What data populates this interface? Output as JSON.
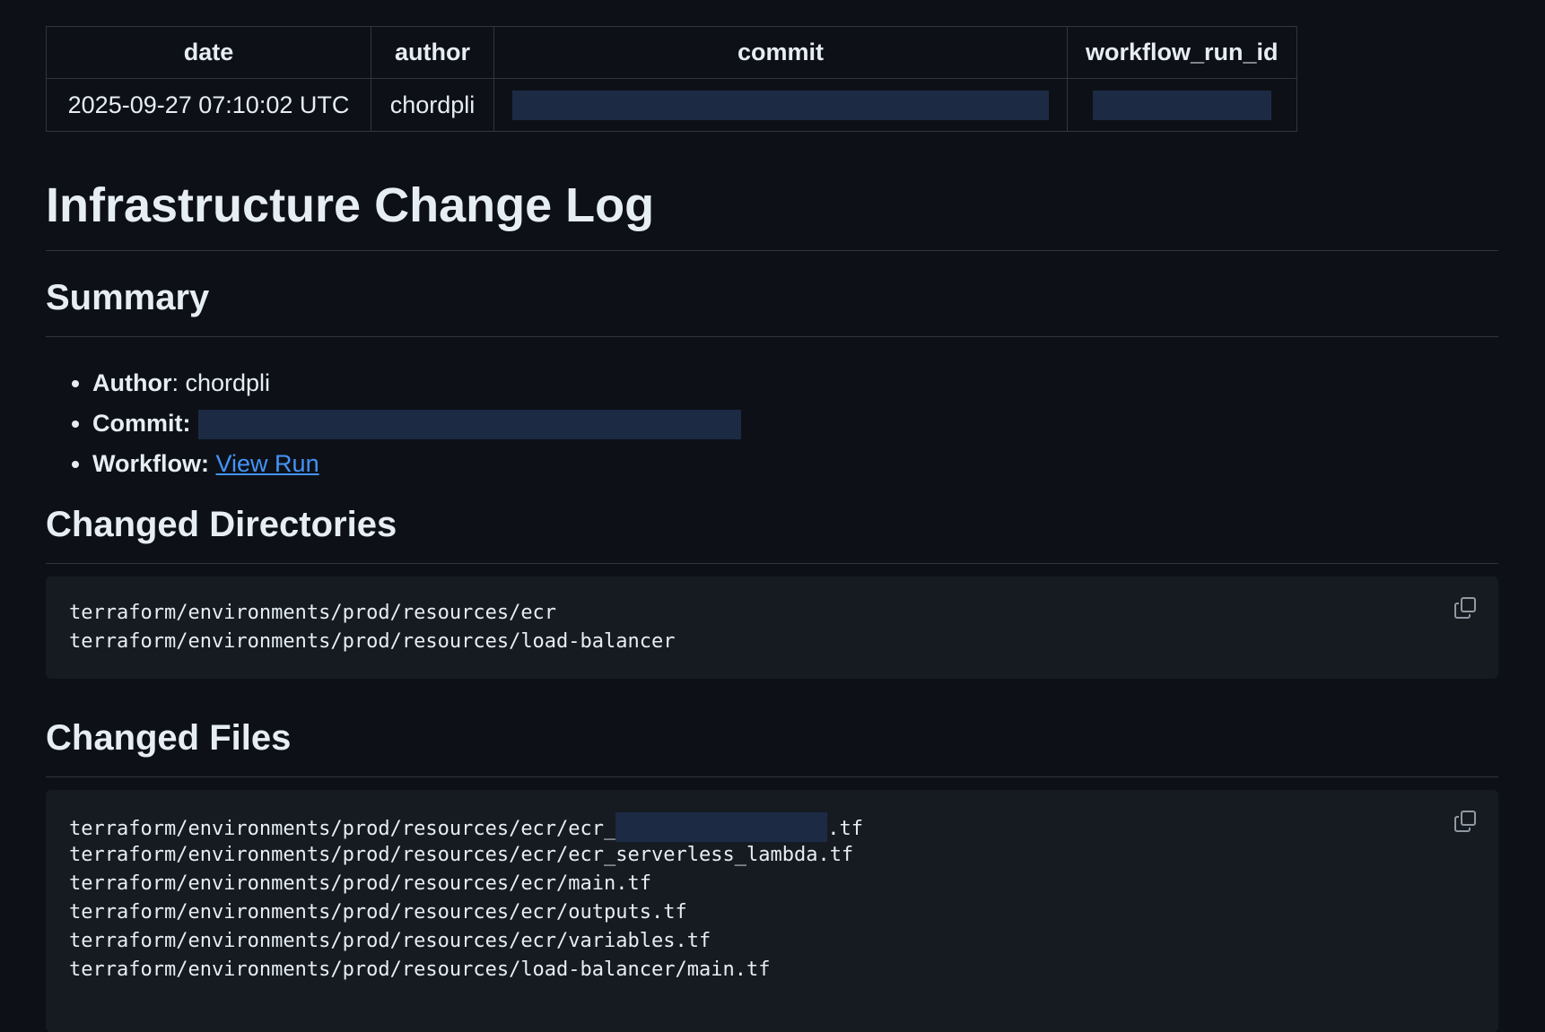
{
  "table": {
    "headers": {
      "date": "date",
      "author": "author",
      "commit": "commit",
      "workflow_run_id": "workflow_run_id"
    },
    "row": {
      "date": "2025-09-27 07:10:02 UTC",
      "author": "chordpli"
    }
  },
  "title": "Infrastructure Change Log",
  "summary": {
    "heading": "Summary",
    "author_label": "Author",
    "author_value": ": chordpli",
    "commit_label": "Commit:",
    "workflow_label": "Workflow:",
    "workflow_link": "View Run"
  },
  "changed_directories": {
    "heading": "Changed Directories",
    "lines": [
      "terraform/environments/prod/resources/ecr",
      "terraform/environments/prod/resources/load-balancer"
    ]
  },
  "changed_files": {
    "heading": "Changed Files",
    "first_line_prefix": "terraform/environments/prod/resources/ecr/ecr_",
    "first_line_suffix": ".tf",
    "lines": [
      "terraform/environments/prod/resources/ecr/ecr_serverless_lambda.tf",
      "terraform/environments/prod/resources/ecr/main.tf",
      "terraform/environments/prod/resources/ecr/outputs.tf",
      "terraform/environments/prod/resources/ecr/variables.tf",
      "terraform/environments/prod/resources/load-balancer/main.tf"
    ]
  },
  "icons": {
    "copy": "copy-icon"
  },
  "colors": {
    "background": "#0d1117",
    "code_background": "#161b22",
    "border": "#30363d",
    "link": "#4493f8",
    "redaction": "#1c2a44"
  }
}
